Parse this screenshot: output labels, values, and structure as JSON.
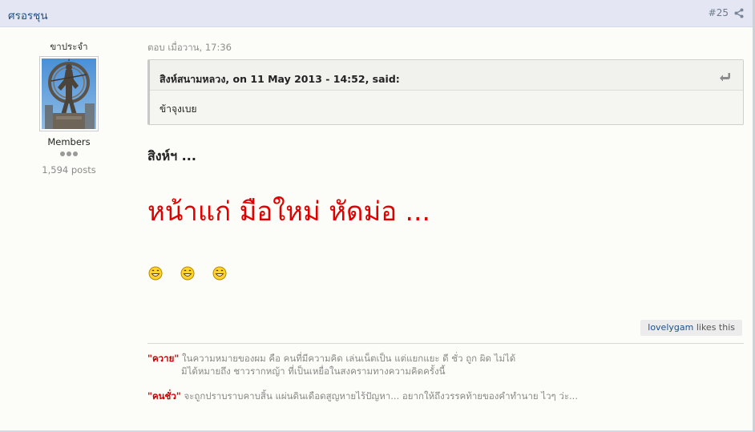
{
  "header": {
    "author": "ศรอรชุน",
    "post_number": "#25",
    "share_icon": "share-icon"
  },
  "author_panel": {
    "title": "ขาประจำ",
    "avatar_alt": "avatar",
    "group": "Members",
    "posts": "1,594 posts"
  },
  "post": {
    "posted": "ตอบ เมื่อวาน, 17:36",
    "quote": {
      "cite": "สิงห์สนามหลวง, on 11 May 2013 - 14:52, said:",
      "body": "ข้าจุงเบย"
    },
    "line1": "สิงห์ฯ ...",
    "line2": "หน้าแก่ มือใหม่ หัดม่อ  ...",
    "smileys": [
      "biggrin-icon",
      "biggrin-icon",
      "biggrin-icon"
    ]
  },
  "likes": {
    "user": "lovelygam",
    "suffix": " likes this"
  },
  "signature": {
    "kw1": "\"ควาย\"",
    "text1a": " ในความหมายของผม คือ คนที่มีความคิด เล่นเน็ตเป็น แต่แยกแยะ ดี ชั่ว ถูก ผิด ไม่ได้",
    "text1b": "มิได้หมายถึง ชาวรากหญ้า ที่เป็นเหยื่อในสงครามทางความคิดครั้งนี้",
    "kw2": "\"คนชั่ว\"",
    "text2": " จะถูกปราบราบคาบสิ้น แผ่นดินเดือดสูญหายไร้ปัญหา... อยากให้ถึงวรรคท้ายของคำทำนาย ไวๆ ว่ะ..."
  },
  "colors": {
    "header_bg": "#e4e7f3",
    "link": "#1d4f8c",
    "red": "#e00000"
  }
}
